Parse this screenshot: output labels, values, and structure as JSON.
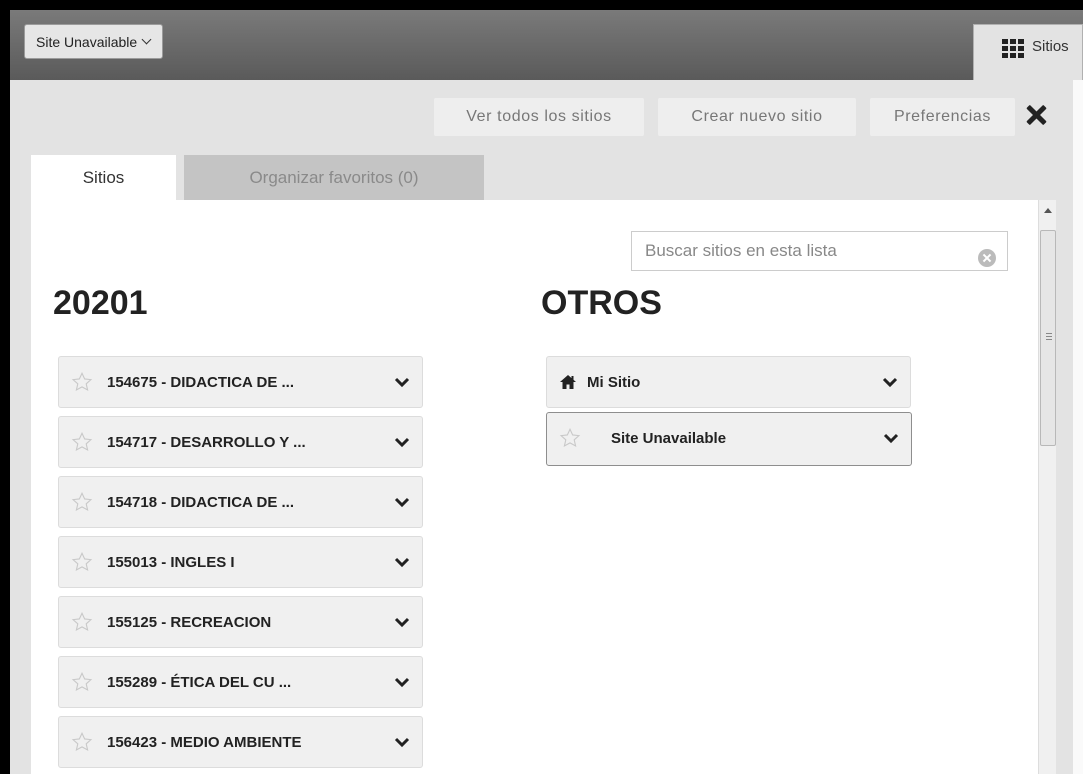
{
  "topbar": {
    "site_selector_label": "Site Unavailable",
    "sitios_label": "Sitios"
  },
  "actions": {
    "view_all": "Ver todos los sitios",
    "create_new": "Crear nuevo sitio",
    "preferences": "Preferencias"
  },
  "tabs": {
    "sites": "Sitios",
    "organize": "Organizar favoritos (0)"
  },
  "search": {
    "placeholder": "Buscar sitios en esta lista"
  },
  "columns": {
    "left_title": "20201",
    "right_title": "OTROS"
  },
  "left_sites": [
    "154675 - DIDACTICA DE ...",
    "154717 - DESARROLLO Y ...",
    "154718 - DIDACTICA DE ...",
    "155013 - INGLES I",
    "155125 - RECREACION",
    "155289 - ÉTICA DEL CU ...",
    "156423 - MEDIO AMBIENTE"
  ],
  "right_sites": [
    "Mi Sitio",
    "Site Unavailable"
  ]
}
